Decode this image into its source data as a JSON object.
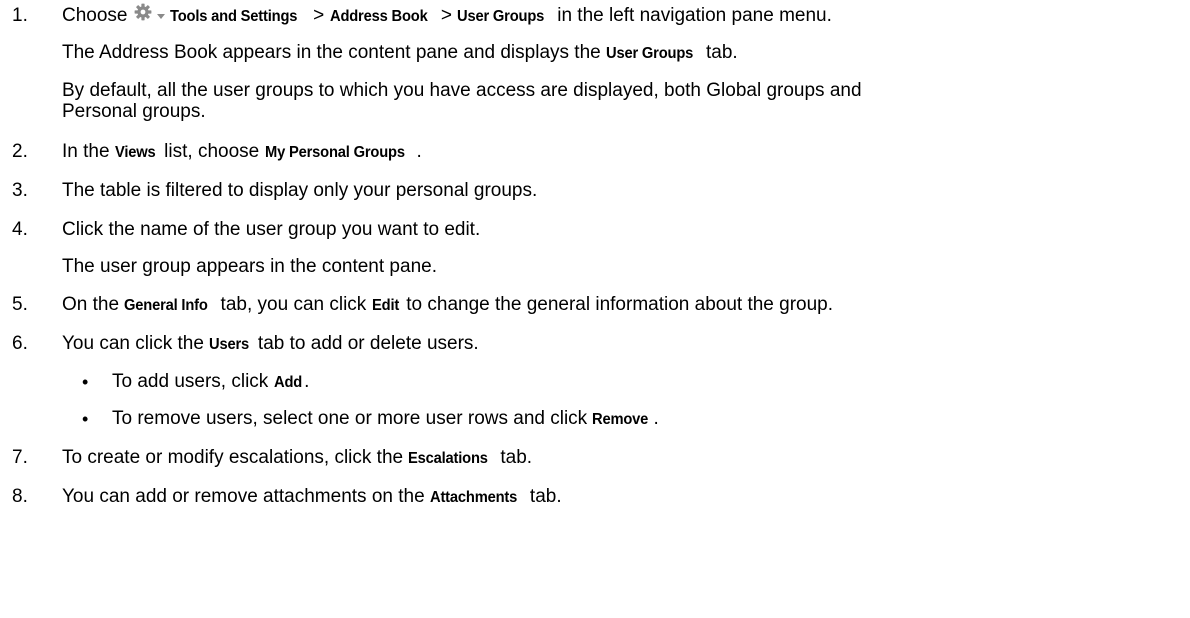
{
  "steps": [
    {
      "num": "1.",
      "pre": "Choose",
      "gear_icon": "gear-icon",
      "caret_icon": "caret-down-icon",
      "b1": "Tools and Settings",
      "sep1": " > ",
      "b2": "Address Book",
      "sep2": " > ",
      "b3": "User Groups",
      "post": " in the left navigation pane menu.",
      "p2_pre": "The Address Book appears in the content pane and displays the ",
      "p2_b": "User Groups",
      "p2_post": " tab.",
      "p3a": "By default, all the user groups to which you have access are displayed, both Global groups and",
      "p3b": "Personal groups."
    },
    {
      "num": "2.",
      "pre": "In the ",
      "b1": "Views",
      "mid": " list, choose ",
      "b2": "My Personal Groups",
      "post": "."
    },
    {
      "num": "3.",
      "text": "The table is filtered to display only your personal groups."
    },
    {
      "num": "4.",
      "text": "Click the name of the user group you want to edit.",
      "p2": "The user group appears in the content pane."
    },
    {
      "num": "5.",
      "pre": "On the ",
      "b1": "General Info",
      "mid1": " tab, you can click ",
      "b2": "Edit",
      "post": " to change the general information about the group."
    },
    {
      "num": "6.",
      "pre": "You can click the ",
      "b1": "Users",
      "post": " tab to add or delete users.",
      "bullets": [
        {
          "pre": "To add users, click ",
          "b": "Add",
          "post": "."
        },
        {
          "pre": "To remove users, select one or more user rows and click ",
          "b": "Remove",
          "post": "."
        }
      ]
    },
    {
      "num": "7.",
      "pre": "To create or modify escalations, click the ",
      "b1": "Escalations",
      "post": " tab."
    },
    {
      "num": "8.",
      "pre": "You can add or remove attachments on the ",
      "b1": "Attachments",
      "post": " tab."
    }
  ],
  "bullet_char": "•"
}
